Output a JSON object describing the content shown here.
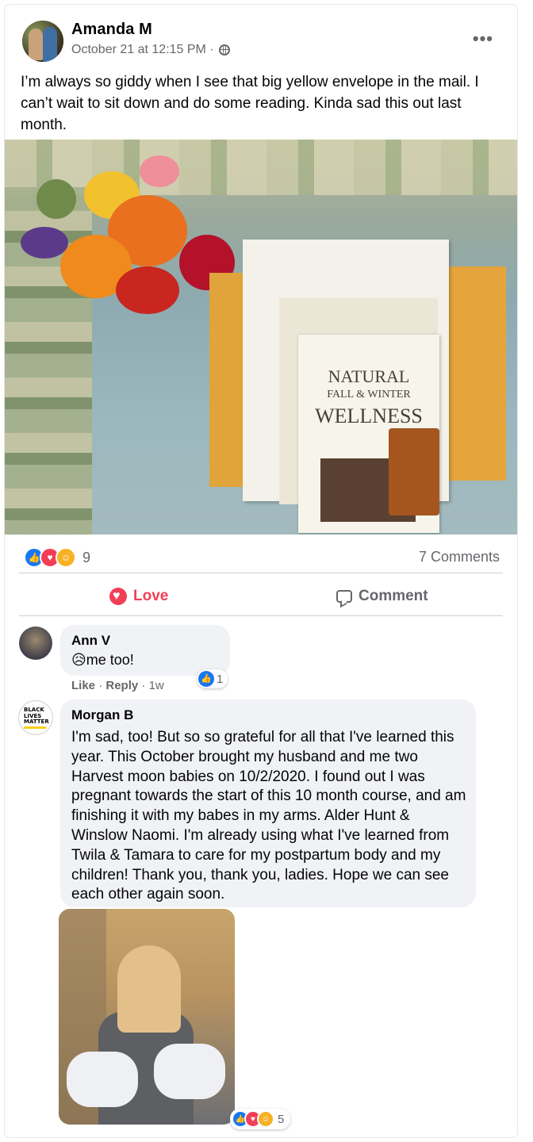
{
  "post": {
    "author": "Amanda M",
    "timestamp": "October 21 at 12:15 PM ·",
    "more_label": "•••",
    "text": "I’m always so giddy when I see that big yellow envelope in the mail. I can’t wait to sit down and do some reading. Kinda sad this out last month.",
    "photo_text": {
      "title_line1": "NATURAL",
      "title_line2": "FALL & WINTER",
      "title_line3": "WELLNESS"
    }
  },
  "reactions": {
    "icons": [
      "like-icon",
      "love-icon",
      "care-icon"
    ],
    "count": "9",
    "comments_count": "7 Comments"
  },
  "actions": {
    "love_label": "Love",
    "comment_label": "Comment"
  },
  "comments": [
    {
      "name": "Ann V",
      "text": "😥me too!",
      "like_label": "Like",
      "reply_label": "Reply",
      "time": "1w",
      "reaction_count": "1"
    },
    {
      "name": "Morgan B",
      "avatar_text": "BLACK LIVES MATTER",
      "text": "I'm sad, too! But so so grateful for all that I've learned this year. This October brought my husband and me two Harvest moon babies on 10/2/2020. I found out I was pregnant towards the start of this 10 month course, and am finishing it with my babes in my arms. Alder Hunt & Winslow Naomi. I'm already using what I've learned from Twila & Tamara to care for my postpartum body and my children! Thank you, thank you, ladies. Hope we can see each other again soon.",
      "photo_reaction_count": "5"
    }
  ],
  "colors": {
    "love": "#f33e58",
    "like": "#1877f2",
    "secondary_text": "#65676b",
    "bubble_bg": "#f0f2f5"
  }
}
